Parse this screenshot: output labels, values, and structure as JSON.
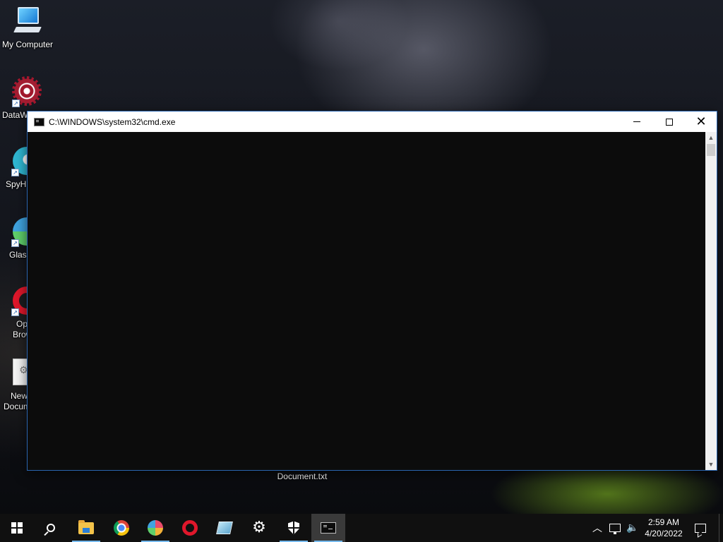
{
  "desktop": {
    "icons": [
      {
        "label": "My Computer",
        "icon": "computer-icon"
      },
      {
        "label": "DataW",
        "icon": "datawrapper-icon"
      },
      {
        "label": "SpyHu",
        "icon": "spyhunter-icon"
      },
      {
        "label": "Glass",
        "icon": "glass-icon"
      },
      {
        "label_line1": "Op",
        "label_line2": "Brow",
        "icon": "opera-icon"
      },
      {
        "label_line1": "New",
        "label_line2": "Docum",
        "icon": "document-icon"
      }
    ],
    "document_label": "Document.txt"
  },
  "cmd_window": {
    "title": "C:\\WINDOWS\\system32\\cmd.exe",
    "console_text": "",
    "colors": {
      "console_bg": "#0c0c0c",
      "title_bg": "#ffffff"
    }
  },
  "taskbar": {
    "apps": [
      {
        "name": "file-explorer",
        "icon": "folder-icon",
        "running": true
      },
      {
        "name": "chrome",
        "icon": "chrome-icon",
        "running": false
      },
      {
        "name": "glass-browser",
        "icon": "glass-icon",
        "running": true
      },
      {
        "name": "opera",
        "icon": "opera-icon",
        "running": false
      },
      {
        "name": "app",
        "icon": "app-icon",
        "running": false
      },
      {
        "name": "settings",
        "icon": "gear-icon",
        "running": false
      },
      {
        "name": "security",
        "icon": "shield-icon",
        "running": false
      },
      {
        "name": "command-prompt",
        "icon": "cmd-icon",
        "running": true,
        "active": true
      }
    ],
    "clock": {
      "time": "2:59 AM",
      "date": "4/20/2022"
    },
    "accent": "#76b9ed"
  }
}
